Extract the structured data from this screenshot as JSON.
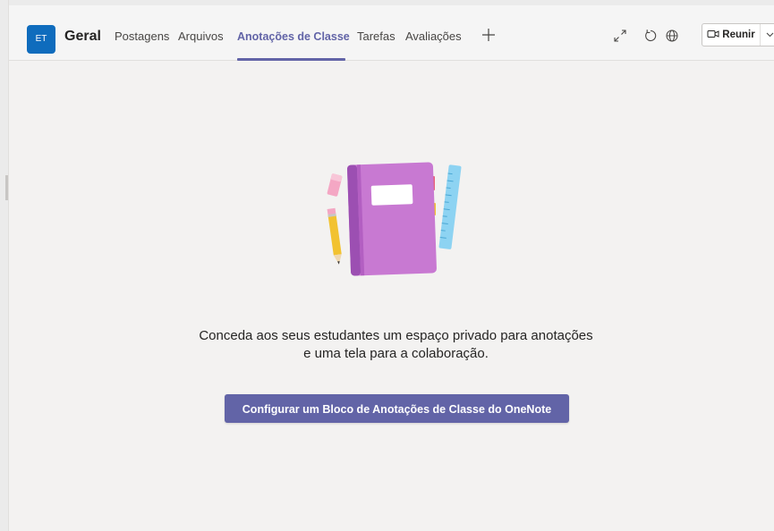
{
  "colors": {
    "accent": "#6264a7",
    "avatar_bg": "#0f6cbd",
    "page_bg": "#f3f2f1"
  },
  "header": {
    "team_avatar_initials": "ET",
    "channel_name": "Geral",
    "tabs": [
      {
        "label": "Postagens",
        "active": false
      },
      {
        "label": "Arquivos",
        "active": false
      },
      {
        "label": "Anotações de Classe",
        "active": true
      },
      {
        "label": "Tarefas",
        "active": false
      },
      {
        "label": "Avaliações",
        "active": false
      }
    ],
    "add_tab_icon": "plus-icon",
    "icons": [
      "expand-icon",
      "refresh-icon",
      "globe-icon"
    ],
    "meet_button": {
      "label": "Reunir",
      "icon": "video-camera-icon",
      "dropdown_icon": "chevron-down-icon"
    }
  },
  "main": {
    "illustration": "notebook-with-pencil-eraser-ruler",
    "message_line1": "Conceda aos seus estudantes um espaço privado para anotações",
    "message_line2": "e uma tela para a colaboração.",
    "cta_label": "Configurar um Bloco de Anotações de Classe do OneNote"
  }
}
